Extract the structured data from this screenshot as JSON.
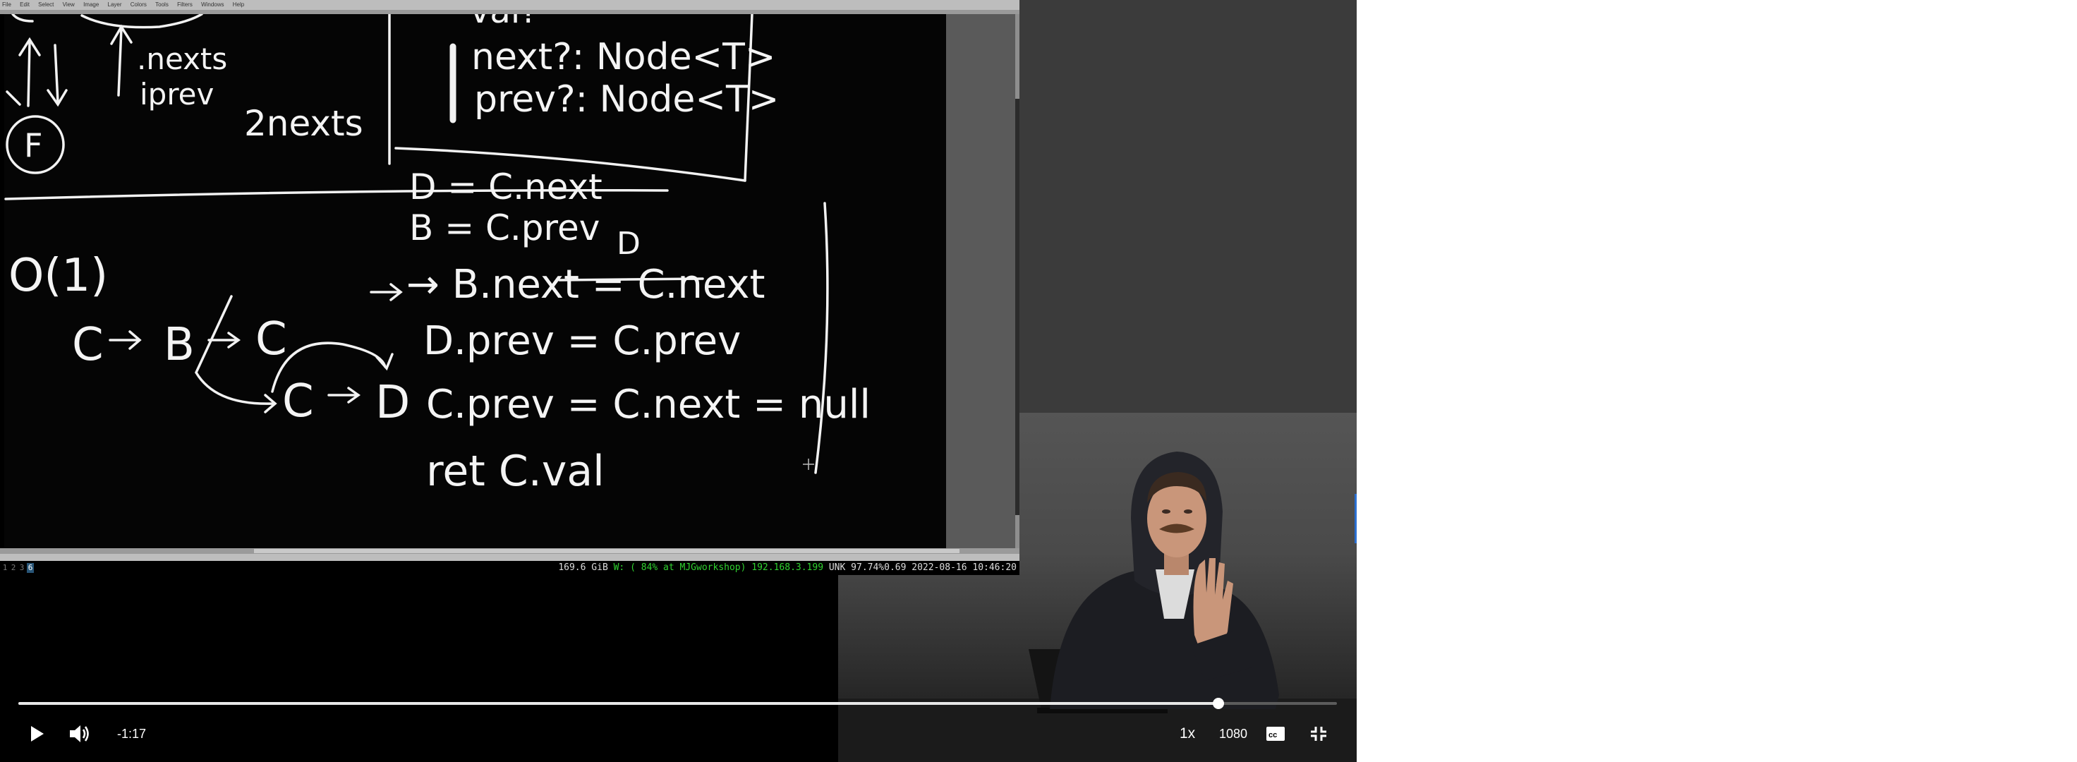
{
  "gimp": {
    "menu": [
      "File",
      "Edit",
      "Select",
      "View",
      "Image",
      "Layer",
      "Colors",
      "Tools",
      "Filters",
      "Windows",
      "Help"
    ]
  },
  "whiteboard": {
    "top_left": {
      "nexts": ".nexts",
      "prev": "iprev",
      "node": "F"
    },
    "two_nexts": "2nexts",
    "type_box": {
      "val": "val?",
      "next": "next?: Node<T>",
      "prev": "prev?: Node<T>"
    },
    "complexity": "O(1)",
    "diagram": {
      "c1": "C",
      "b": "B",
      "c_struck": "C",
      "c2": "C",
      "d": "D"
    },
    "code": [
      "D = C.next",
      "B = C.prev",
      "→ B.next = C.next",
      "D.prev = C.prev",
      "C.prev = C.next = null",
      "ret C.val"
    ],
    "annotation_d": "D"
  },
  "statusbar": {
    "workspaces": [
      "1",
      "2",
      "3",
      "6"
    ],
    "active_workspace": "6",
    "disk": "169.6 GiB",
    "wifi": "W: ( 84% at MJGworkshop) 192.168.3.199",
    "ethernet": "UNK",
    "battery": "97.74%",
    "load": "0.69",
    "datetime": "2022-08-16 10:46:20"
  },
  "player": {
    "time_remaining": "-1:17",
    "speed": "1x",
    "quality": "1080",
    "progress_fraction": 0.91,
    "play_icon": "play-icon",
    "volume_icon": "volume-icon",
    "captions_icon": "captions-icon",
    "exit_fullscreen_icon": "exit-fullscreen-icon"
  },
  "colors": {
    "accent_green": "#2fd12f",
    "workspace_active": "#285577"
  }
}
